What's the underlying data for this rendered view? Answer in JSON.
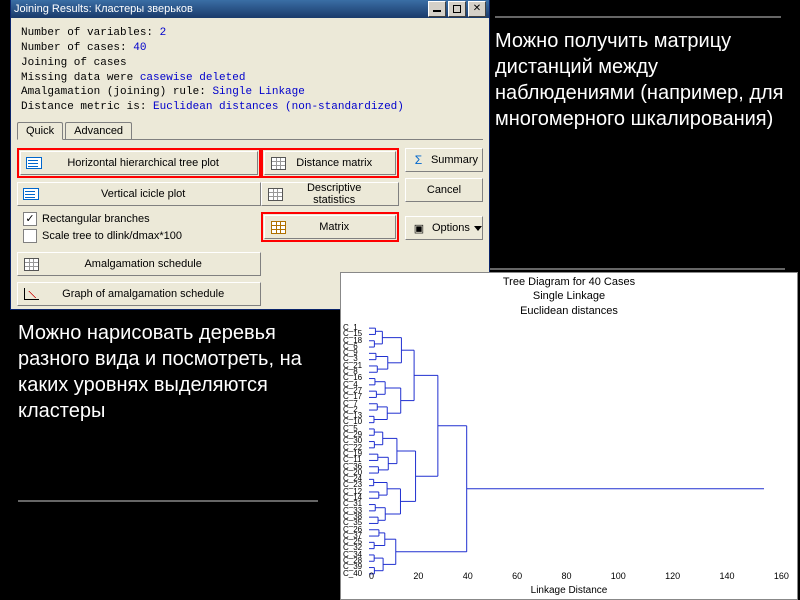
{
  "window": {
    "title": "Joining Results: Кластеры зверьков",
    "buttons": {
      "min": "_",
      "max": "□",
      "close": "×"
    }
  },
  "info": {
    "l1a": "Number of variables: ",
    "l1b": "2",
    "l2a": "Number of cases: ",
    "l2b": "40",
    "l3": "Joining of cases",
    "l4a": "Missing data were ",
    "l4b": "casewise deleted",
    "l5a": "Amalgamation (joining) rule: ",
    "l5b": "Single Linkage",
    "l6a": "Distance metric is: ",
    "l6b": "Euclidean distances (non-standardized)"
  },
  "tabs": {
    "quick": "Quick",
    "advanced": "Advanced"
  },
  "buttons": {
    "htree": "Horizontal hierarchical tree plot",
    "vicicle": "Vertical icicle plot",
    "rect": "Rectangular branches",
    "scale": "Scale tree to dlink/dmax*100",
    "amalg": "Amalgamation schedule",
    "gamalg": "Graph of amalgamation schedule",
    "distm": "Distance matrix",
    "desc": "Descriptive statistics",
    "matrix": "Matrix",
    "summary": "Summary",
    "cancel": "Cancel",
    "options": "Options"
  },
  "checks": {
    "rect": true,
    "scale": false
  },
  "callout1": "Можно получить матрицу дистанций между наблюдениями (например, для многомерного шкалирования)",
  "callout2": "Можно нарисовать деревья разного вида и посмотреть, на каких уровнях выделяются кластеры",
  "chart": {
    "title": "Tree Diagram for 40 Cases",
    "sub1": "Single Linkage",
    "sub2": "Euclidean distances",
    "xlabel": "Linkage Distance",
    "xticks": [
      "0",
      "20",
      "40",
      "60",
      "80",
      "100",
      "120",
      "140",
      "160"
    ],
    "ylabels": [
      "C_1",
      "C_15",
      "C_18",
      "C_6",
      "C_9",
      "C_3",
      "C_21",
      "C_8",
      "C_16",
      "C_4",
      "C_27",
      "C_17",
      "C_7",
      "C_2",
      "C_13",
      "C_10",
      "C_5",
      "C_29",
      "C_30",
      "C_22",
      "C_19",
      "C_11",
      "C_36",
      "C_20",
      "C_24",
      "C_23",
      "C_12",
      "C_14",
      "C_31",
      "C_33",
      "C_38",
      "C_35",
      "C_26",
      "C_37",
      "C_25",
      "C_32",
      "C_34",
      "C_28",
      "C_39",
      "C_40"
    ]
  },
  "chart_data": {
    "type": "dendrogram",
    "title": "Tree Diagram for 40 Cases",
    "xlabel": "Linkage Distance",
    "ylabel": "",
    "xlim": [
      0,
      160
    ],
    "n_cases": 40,
    "method": "Single Linkage",
    "metric": "Euclidean distances",
    "max_linkage": 150,
    "leaf_labels": [
      "C_1",
      "C_15",
      "C_18",
      "C_6",
      "C_9",
      "C_3",
      "C_21",
      "C_8",
      "C_16",
      "C_4",
      "C_27",
      "C_17",
      "C_7",
      "C_2",
      "C_13",
      "C_10",
      "C_5",
      "C_29",
      "C_30",
      "C_22",
      "C_19",
      "C_11",
      "C_36",
      "C_20",
      "C_24",
      "C_23",
      "C_12",
      "C_14",
      "C_31",
      "C_33",
      "C_38",
      "C_35",
      "C_26",
      "C_37",
      "C_25",
      "C_32",
      "C_34",
      "C_28",
      "C_39",
      "C_40"
    ]
  }
}
